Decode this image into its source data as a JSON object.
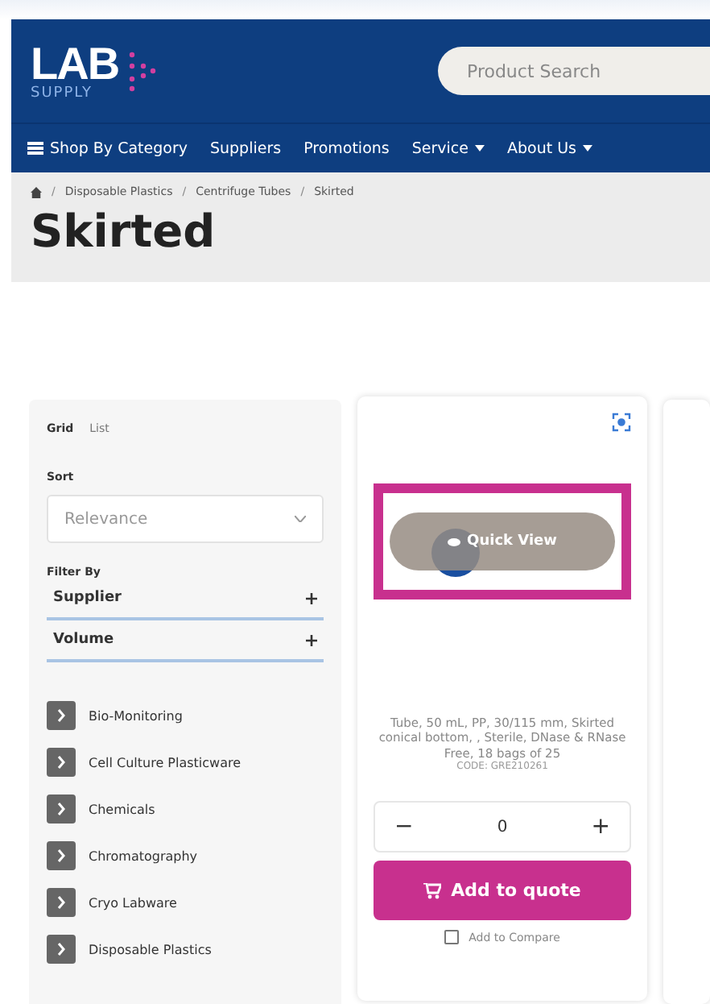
{
  "header": {
    "logo": {
      "word": "LAB",
      "tagline": "SUPPLY"
    },
    "search": {
      "placeholder": "Product Search"
    },
    "nav": [
      {
        "label": "Shop By Category",
        "kind": "menu"
      },
      {
        "label": "Suppliers",
        "kind": "link"
      },
      {
        "label": "Promotions",
        "kind": "link"
      },
      {
        "label": "Service",
        "kind": "dropdown"
      },
      {
        "label": "About Us",
        "kind": "dropdown"
      }
    ]
  },
  "breadcrumb": {
    "separator": "/",
    "items": [
      "Disposable Plastics",
      "Centrifuge Tubes",
      "Skirted"
    ]
  },
  "title": "Skirted",
  "sidebar": {
    "views": [
      {
        "label": "Grid",
        "selected": true
      },
      {
        "label": "List",
        "selected": false
      }
    ],
    "sort": {
      "label": "Sort",
      "value": "Relevance"
    },
    "filter_label": "Filter By",
    "filters": [
      {
        "label": "Supplier",
        "expanded": false
      },
      {
        "label": "Volume",
        "expanded": false
      }
    ],
    "categories": [
      "Bio-Monitoring",
      "Cell Culture Plasticware",
      "Chemicals",
      "Chromatography",
      "Cryo Labware",
      "Disposable Plastics"
    ]
  },
  "product": {
    "quick_view": "Quick View",
    "highlighted": true,
    "description": "Tube, 50 mL, PP, 30/115 mm, Skirted conical bottom, , Sterile, DNase & RNase Free, 18 bags of 25",
    "code": "CODE: GRE210261",
    "quantity": "0",
    "decrease": "−",
    "increase": "+",
    "add_button": "Add to quote",
    "compare": {
      "label": "Add to Compare",
      "checked": false
    }
  }
}
